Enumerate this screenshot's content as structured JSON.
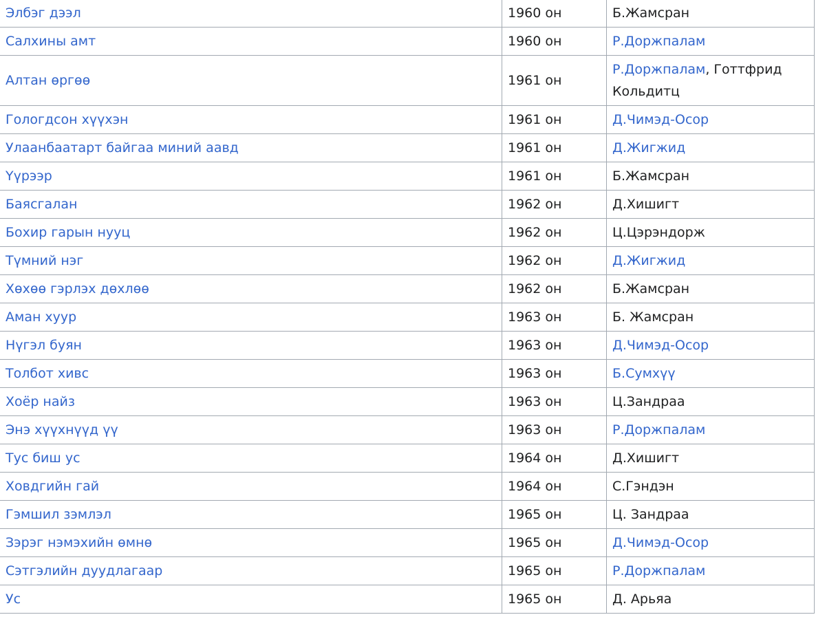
{
  "rows": [
    {
      "title": "Элбэг дээл",
      "year": "1960 он",
      "directors": [
        {
          "text": "Б.Жамсран",
          "link": false
        }
      ]
    },
    {
      "title": "Салхины амт",
      "year": "1960 он",
      "directors": [
        {
          "text": "Р.Доржпалам",
          "link": true
        }
      ]
    },
    {
      "title": "Алтан өргөө",
      "year": "1961 он",
      "directors": [
        {
          "text": "Р.Доржпалам",
          "link": true
        },
        {
          "text": ", Готтфрид Кольдитц",
          "link": false
        }
      ]
    },
    {
      "title": "Гологдсон хүүхэн",
      "year": "1961 он",
      "directors": [
        {
          "text": "Д.Чимэд-Осор",
          "link": true
        }
      ]
    },
    {
      "title": "Улаанбаатарт байгаа миний аавд",
      "year": "1961 он",
      "directors": [
        {
          "text": "Д.Жигжид",
          "link": true
        }
      ]
    },
    {
      "title": "Үүрээр",
      "year": "1961 он",
      "directors": [
        {
          "text": "Б.Жамсран",
          "link": false
        }
      ]
    },
    {
      "title": "Баясгалан",
      "year": "1962 он",
      "directors": [
        {
          "text": "Д.Хишигт",
          "link": false
        }
      ]
    },
    {
      "title": "Бохир гарын нууц",
      "year": "1962 он",
      "directors": [
        {
          "text": "Ц.Цэрэндорж",
          "link": false
        }
      ]
    },
    {
      "title": "Түмний нэг",
      "year": "1962 он",
      "directors": [
        {
          "text": "Д.Жигжид",
          "link": true
        }
      ]
    },
    {
      "title": "Хөхөө гэрлэх дөхлөө",
      "year": "1962 он",
      "directors": [
        {
          "text": "Б.Жамсран",
          "link": false
        }
      ]
    },
    {
      "title": "Аман хуур",
      "year": "1963 он",
      "directors": [
        {
          "text": "Б. Жамсран",
          "link": false
        }
      ]
    },
    {
      "title": "Нүгэл буян",
      "year": "1963 он",
      "directors": [
        {
          "text": "Д.Чимэд-Осор",
          "link": true
        }
      ]
    },
    {
      "title": "Толбот хивс",
      "year": "1963 он",
      "directors": [
        {
          "text": "Б.Сумхүү",
          "link": true
        }
      ]
    },
    {
      "title": "Хоёр найз",
      "year": "1963 он",
      "directors": [
        {
          "text": "Ц.Зандраа",
          "link": false
        }
      ]
    },
    {
      "title": "Энэ хүүхнүүд үү",
      "year": "1963 он",
      "directors": [
        {
          "text": "Р.Доржпалам",
          "link": true
        }
      ]
    },
    {
      "title": "Тус биш ус",
      "year": "1964 он",
      "directors": [
        {
          "text": "Д.Хишигт",
          "link": false
        }
      ]
    },
    {
      "title": "Ховдгийн гай",
      "year": "1964 он",
      "directors": [
        {
          "text": "С.Гэндэн",
          "link": false
        }
      ]
    },
    {
      "title": "Гэмшил зэмлэл",
      "year": "1965 он",
      "directors": [
        {
          "text": "Ц. Зандраа",
          "link": false
        }
      ]
    },
    {
      "title": "Зэрэг нэмэхийн өмнө",
      "year": "1965 он",
      "directors": [
        {
          "text": "Д.Чимэд-Осор",
          "link": true
        }
      ]
    },
    {
      "title": "Сэтгэлийн дуудлагаар",
      "year": "1965 он",
      "directors": [
        {
          "text": "Р.Доржпалам",
          "link": true
        }
      ]
    },
    {
      "title": "Ус",
      "year": "1965 он",
      "directors": [
        {
          "text": "Д. Арьяа",
          "link": false
        }
      ]
    }
  ],
  "colors": {
    "link": "#3366cc",
    "text": "#202122",
    "border": "#a2a9b1"
  }
}
